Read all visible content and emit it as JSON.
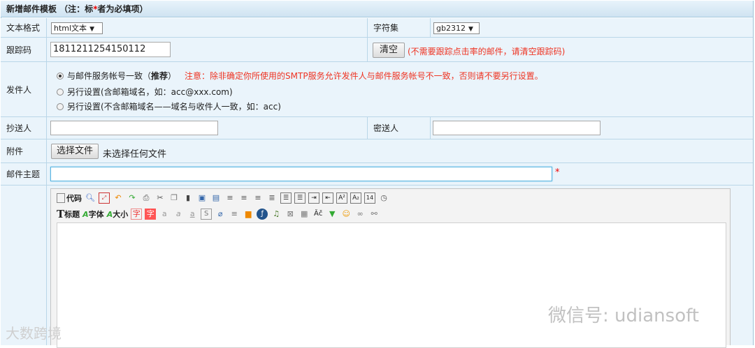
{
  "header": {
    "title_prefix": "新增邮件模板 （注：标",
    "title_star": "*",
    "title_suffix": "者为必填项）"
  },
  "rows": {
    "format": {
      "label": "文本格式",
      "value": "html文本"
    },
    "charset": {
      "label": "字符集",
      "value": "gb2312"
    },
    "tracking": {
      "label": "跟踪码",
      "value": "1811211254150112",
      "clear_button": "清空",
      "note": "(不需要跟踪点击率的邮件，请清空跟踪码)"
    },
    "sender": {
      "label": "发件人",
      "option1_prefix": "与邮件服务帐号一致（",
      "option1_bold": "推荐",
      "option1_suffix": "）",
      "warning": "注意：除非确定你所使用的SMTP服务允许发件人与邮件服务帐号不一致，否则请不要另行设置。",
      "option2": "另行设置(含邮箱域名，如：acc@xxx.com)",
      "option3": "另行设置(不含邮箱域名——域名与收件人一致，如：acc)"
    },
    "cc": {
      "label": "抄送人",
      "value": ""
    },
    "bcc": {
      "label": "密送人",
      "value": ""
    },
    "attachment": {
      "label": "附件",
      "button": "选择文件",
      "status": "未选择任何文件"
    },
    "subject": {
      "label": "邮件主题",
      "value": "",
      "required": "*"
    }
  },
  "toolbar": {
    "code_label": "代码",
    "heading_label": "标题",
    "font_label": "字体",
    "size_label": "大小",
    "row1_icons": [
      "search-icon",
      "fullscreen-icon",
      "undo-icon",
      "redo-icon",
      "print-icon",
      "cut-icon",
      "copy-icon",
      "paste-icon",
      "paste-text-icon",
      "paste-word-icon",
      "align-left-icon",
      "align-center-icon",
      "align-right-icon",
      "align-justify-icon",
      "ordered-list-icon",
      "unordered-list-icon",
      "indent-icon",
      "outdent-icon",
      "superscript-icon",
      "subscript-icon",
      "date-icon",
      "time-icon"
    ],
    "row2_icons": [
      "font-color-icon",
      "bg-color-icon",
      "bold-icon",
      "italic-icon",
      "underline-icon",
      "strikethrough-icon",
      "remove-format-icon",
      "select-all-icon",
      "image-icon",
      "flash-icon",
      "media-icon",
      "table-icon",
      "hr-icon",
      "spellcheck-icon",
      "special-char-icon",
      "emoticon-icon",
      "link-icon",
      "unlink-icon"
    ],
    "row2_glyphs": [
      "字",
      "字",
      "a",
      "𝑎",
      "a",
      "S",
      "⌀",
      "≡",
      "▦",
      "ƒ",
      "♫",
      "⊞",
      "▤",
      "Ǎč",
      "▼",
      "☺",
      "∞",
      "✂"
    ]
  },
  "watermarks": {
    "right": "微信号: udiansoft",
    "left": "大数跨境"
  }
}
